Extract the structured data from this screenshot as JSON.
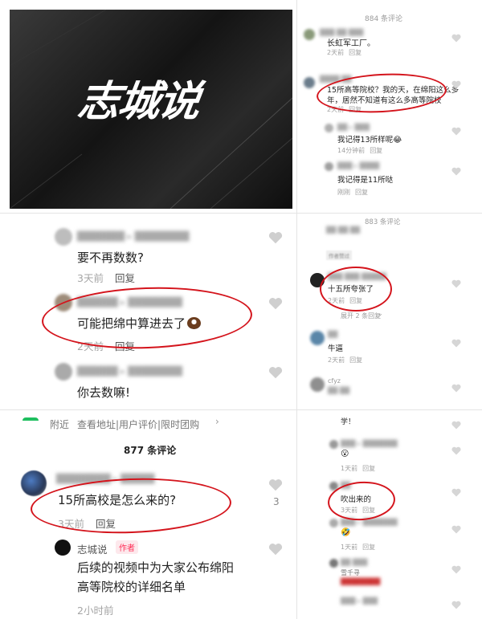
{
  "logo": {
    "text": "志城说"
  },
  "right_top": {
    "comment_count": "884 条评论",
    "comments": [
      {
        "text": "长虹军工厂。",
        "time": "2天前",
        "reply": "回复"
      },
      {
        "text_line1": "15所高等院校？我的天，在绵阳这么多",
        "text_line2": "年，居然不知道有这么多高等院校",
        "time": "2天前",
        "reply": "回复",
        "likes": "6"
      },
      {
        "text": "我记得13所样呢😂",
        "time": "14分钟前",
        "reply": "回复"
      },
      {
        "text": "我记得是11所哒",
        "time": "刚刚",
        "reply": "回复"
      }
    ]
  },
  "left_mid": {
    "comments": [
      {
        "text": "要不再数数?",
        "time": "3天前",
        "reply": "回复"
      },
      {
        "text": "可能把绵中算进去了",
        "time": "2天前",
        "reply": "回复"
      },
      {
        "text": "你去数嘛!"
      }
    ]
  },
  "right_mid": {
    "comment_count": "883 条评论",
    "tag": "作者赞过",
    "comments": [
      {
        "text": "十五所夸张了",
        "time": "2天前",
        "reply": "回复"
      },
      {
        "expand": "展开 2 条回复"
      },
      {
        "text": "牛逼",
        "time": "2天前",
        "reply": "回复"
      },
      {
        "name": "cfyz"
      }
    ]
  },
  "left_bottom": {
    "nearby": "附近",
    "nearby_links": "查看地址|用户评价|限时团购",
    "comment_count": "877 条评论",
    "main_comment": {
      "text": "15所高校是怎么来的?",
      "time": "3天前",
      "reply": "回复",
      "likes": "3"
    },
    "author_reply": {
      "name": "志城说",
      "badge": "作者",
      "line1": "后续的视频中为大家公布绵阳",
      "line2": "高等院校的详细名单",
      "time": "2小时前"
    }
  },
  "right_bottom": {
    "comments": [
      {
        "text": "学！"
      },
      {
        "text": "😮",
        "time": "1天前",
        "reply": "回复"
      },
      {
        "text": "吹出来的",
        "time": "3天前",
        "reply": "回复"
      },
      {
        "text": "🤣",
        "time": "1天前",
        "reply": "回复"
      },
      {
        "name": "雪千寻"
      }
    ]
  },
  "colors": {
    "annotation": "#d4141c",
    "author_badge": "#fe2c55",
    "heart": "#cfcfcf"
  }
}
